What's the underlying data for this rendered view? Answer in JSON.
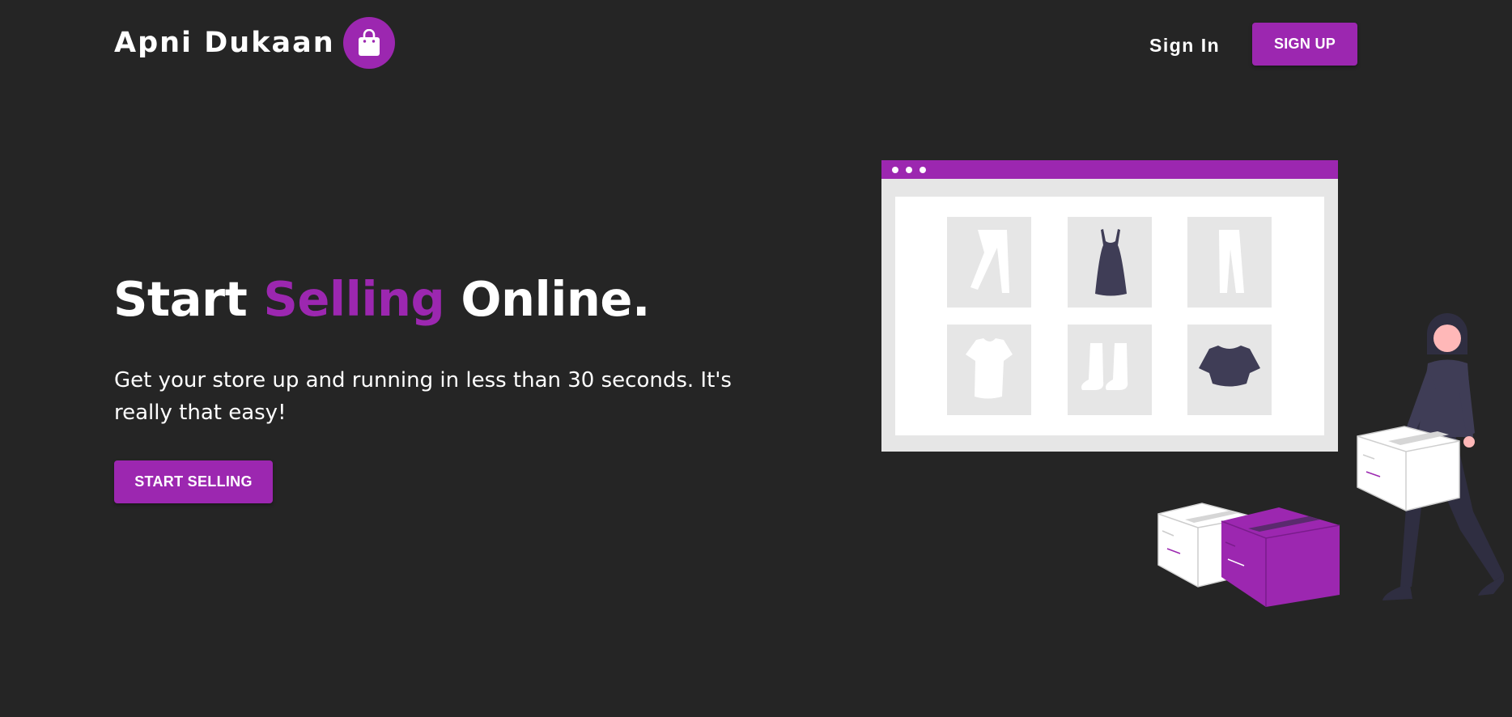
{
  "brand": {
    "name": "Apni Dukaan",
    "icon": "shopping-bag-icon",
    "accent_color": "#9c27b0"
  },
  "nav": {
    "signin_label": "Sign In",
    "signup_label": "SIGN UP"
  },
  "hero": {
    "title_part1": "Start",
    "title_accent": "Selling",
    "title_part2": "Online.",
    "subtitle": "Get your store up and running in less than 30 seconds. It's really that easy!",
    "cta_label": "START SELLING"
  },
  "illustration": {
    "name": "online-store-illustration",
    "products": [
      "pants-icon",
      "dress-icon",
      "trousers-icon",
      "tshirt-icon",
      "boots-icon",
      "crop-top-icon"
    ]
  },
  "colors": {
    "background": "#252525",
    "accent": "#9c27b0",
    "text": "#ffffff"
  }
}
